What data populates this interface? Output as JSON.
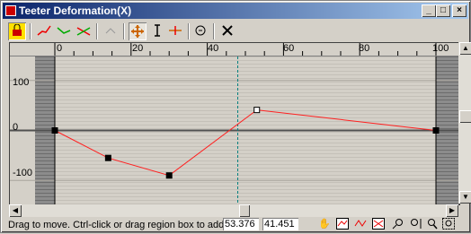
{
  "window": {
    "title": "Teeter Deformation(X)"
  },
  "titlebar_buttons": {
    "minimize": "_",
    "maximize": "□",
    "close": "×"
  },
  "ruler": {
    "labels": [
      "0",
      "20",
      "40",
      "60",
      "80",
      "100"
    ]
  },
  "y_axis": {
    "labels": [
      "100",
      "0",
      "-100"
    ]
  },
  "status": {
    "prompt": "Drag to move. Ctrl-click or drag region box to add to sel",
    "x_value": "53.376",
    "y_value": "41.451"
  },
  "chart_data": {
    "type": "line",
    "x": [
      0,
      14,
      30,
      53,
      100
    ],
    "values": [
      0,
      -55,
      -90,
      41,
      0
    ],
    "xlim": [
      0,
      100
    ],
    "ylim": [
      -130,
      130
    ],
    "x_ticks": [
      0,
      20,
      40,
      60,
      80,
      100
    ],
    "y_ticks": [
      100,
      0,
      -100
    ],
    "selected_point_index": 3,
    "current_frame": 48,
    "grid": true,
    "line_color": "#ff2020"
  },
  "colors": {
    "curve": "#ff2020",
    "title_start": "#0a246a",
    "title_end": "#a6caf0",
    "frame_marker": "#008080"
  }
}
